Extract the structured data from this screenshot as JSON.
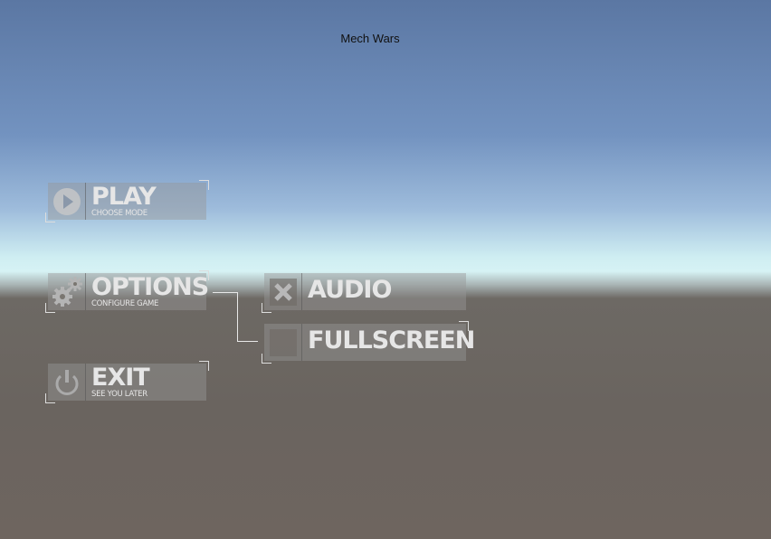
{
  "window": {
    "title": "Mech Wars"
  },
  "menu": [
    {
      "id": "play",
      "label": "PLAY",
      "subtitle": "CHOOSE MODE",
      "icon": "play-icon"
    },
    {
      "id": "options",
      "label": "OPTIONS",
      "subtitle": "CONFIGURE GAME",
      "icon": "gears-icon"
    },
    {
      "id": "exit",
      "label": "EXIT",
      "subtitle": "SEE YOU LATER",
      "icon": "power-icon"
    }
  ],
  "options": [
    {
      "label": "AUDIO",
      "checked": true
    },
    {
      "label": "FULLSCREEN",
      "checked": false
    }
  ]
}
